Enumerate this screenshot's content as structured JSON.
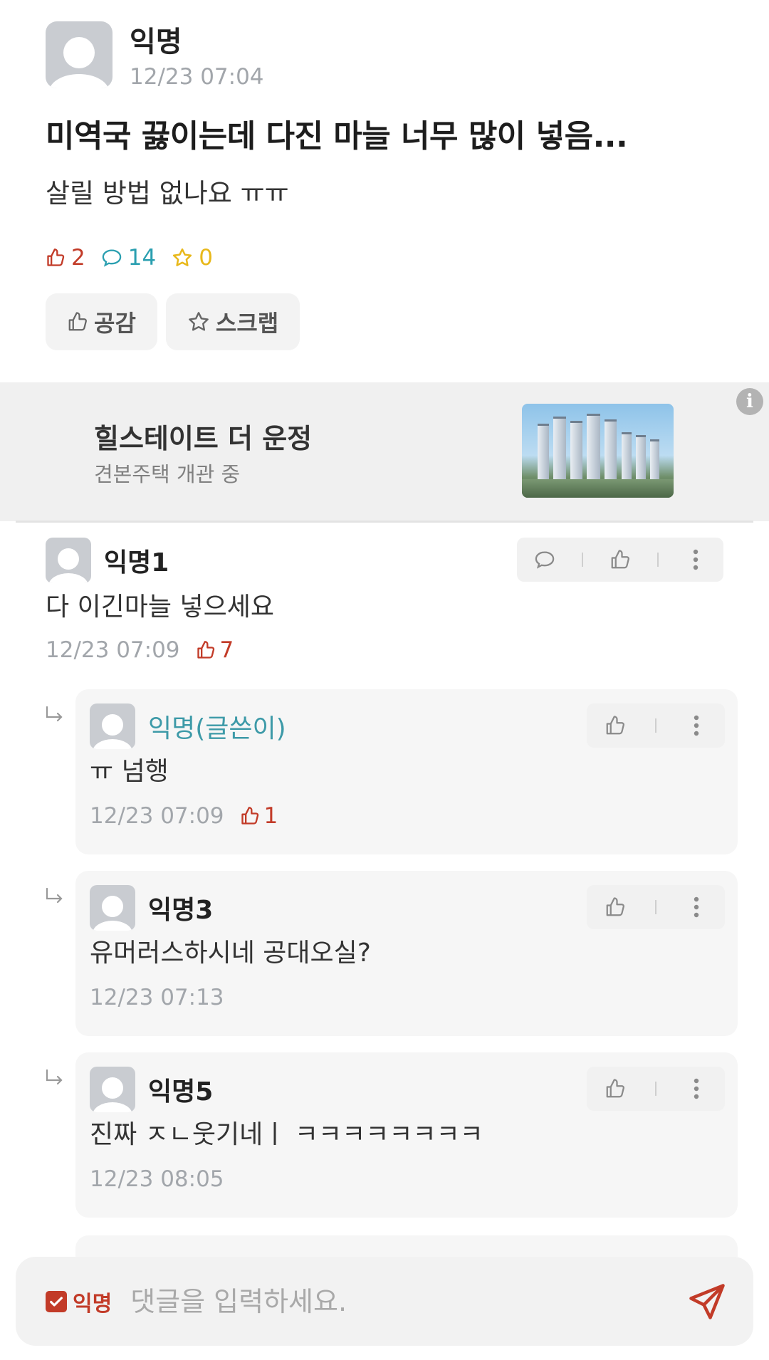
{
  "post": {
    "author": "익명",
    "time": "12/23 07:04",
    "title": "미역국 끓이는데 다진 마늘 너무 많이 넣음...",
    "body": "살릴 방법 없나요 ㅠㅠ",
    "stats": {
      "likes": "2",
      "comments": "14",
      "scraps": "0"
    },
    "actions": {
      "like_label": "공감",
      "scrap_label": "스크랩"
    }
  },
  "ad": {
    "title": "힐스테이트 더 운정",
    "subtitle": "견본주택 개관 중",
    "info_label": "i"
  },
  "comments": [
    {
      "author": "익명1",
      "text": "다 이긴마늘 넣으세요",
      "time": "12/23 07:09",
      "likes": "7"
    }
  ],
  "replies": [
    {
      "author": "익명(글쓴이)",
      "text": "ㅠ 넘행",
      "time": "12/23 07:09",
      "likes": "1"
    },
    {
      "author": "익명3",
      "text": "유머러스하시네 공대오실?",
      "time": "12/23 07:13"
    },
    {
      "author": "익명5",
      "text": "진짜 ㅈㄴ웃기네ㅣ ㅋㅋㅋㅋㅋㅋㅋㅋ",
      "time": "12/23 08:05"
    }
  ],
  "input": {
    "anon_label": "익명",
    "placeholder": "댓글을 입력하세요."
  },
  "colors": {
    "like": "#c23b28",
    "comment": "#2a9fb0",
    "scrap": "#e8b81a",
    "writer": "#3d9aa8"
  }
}
